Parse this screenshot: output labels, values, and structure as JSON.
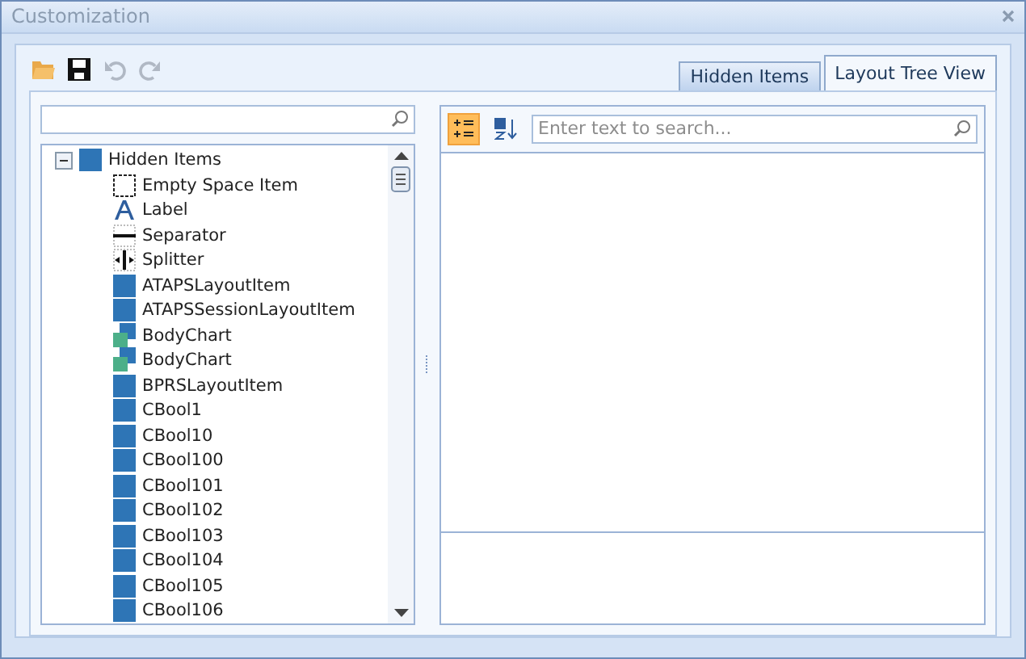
{
  "window": {
    "title": "Customization"
  },
  "toolbar": [
    {
      "kind": "open",
      "disabled": false
    },
    {
      "kind": "save",
      "disabled": false
    },
    {
      "kind": "undo",
      "disabled": true
    },
    {
      "kind": "redo",
      "disabled": true
    }
  ],
  "tabs": [
    {
      "label": "Hidden Items",
      "selected": false
    },
    {
      "label": "Layout Tree View",
      "selected": true
    }
  ],
  "hidden_items": {
    "tree": [
      {
        "label": "Hidden Items",
        "kind": "group",
        "expanded": true,
        "children": [
          {
            "label": "Empty Space Item",
            "kind": "empty"
          },
          {
            "label": "Label",
            "kind": "label"
          },
          {
            "label": "Separator",
            "kind": "separator"
          },
          {
            "label": "Splitter",
            "kind": "splitter"
          },
          {
            "label": "ATAPSLayoutItem",
            "kind": "item"
          },
          {
            "label": "ATAPSSessionLayoutItem",
            "kind": "item"
          },
          {
            "label": "BodyChart",
            "kind": "chart"
          },
          {
            "label": "BodyChart",
            "kind": "chart"
          },
          {
            "label": "BPRSLayoutItem",
            "kind": "item"
          },
          {
            "label": "CBool1",
            "kind": "item"
          },
          {
            "label": "CBool10",
            "kind": "item"
          },
          {
            "label": "CBool100",
            "kind": "item"
          },
          {
            "label": "CBool101",
            "kind": "item"
          },
          {
            "label": "CBool102",
            "kind": "item"
          },
          {
            "label": "CBool103",
            "kind": "item"
          },
          {
            "label": "CBool104",
            "kind": "item"
          },
          {
            "label": "CBool105",
            "kind": "item"
          },
          {
            "label": "CBool106",
            "kind": "item"
          }
        ]
      }
    ]
  },
  "layout_tree": {
    "buttons": [
      {
        "kind": "expand",
        "selected": true
      },
      {
        "kind": "sort",
        "selected": false
      }
    ],
    "search": {
      "placeholder": "Enter text to search..."
    }
  }
}
